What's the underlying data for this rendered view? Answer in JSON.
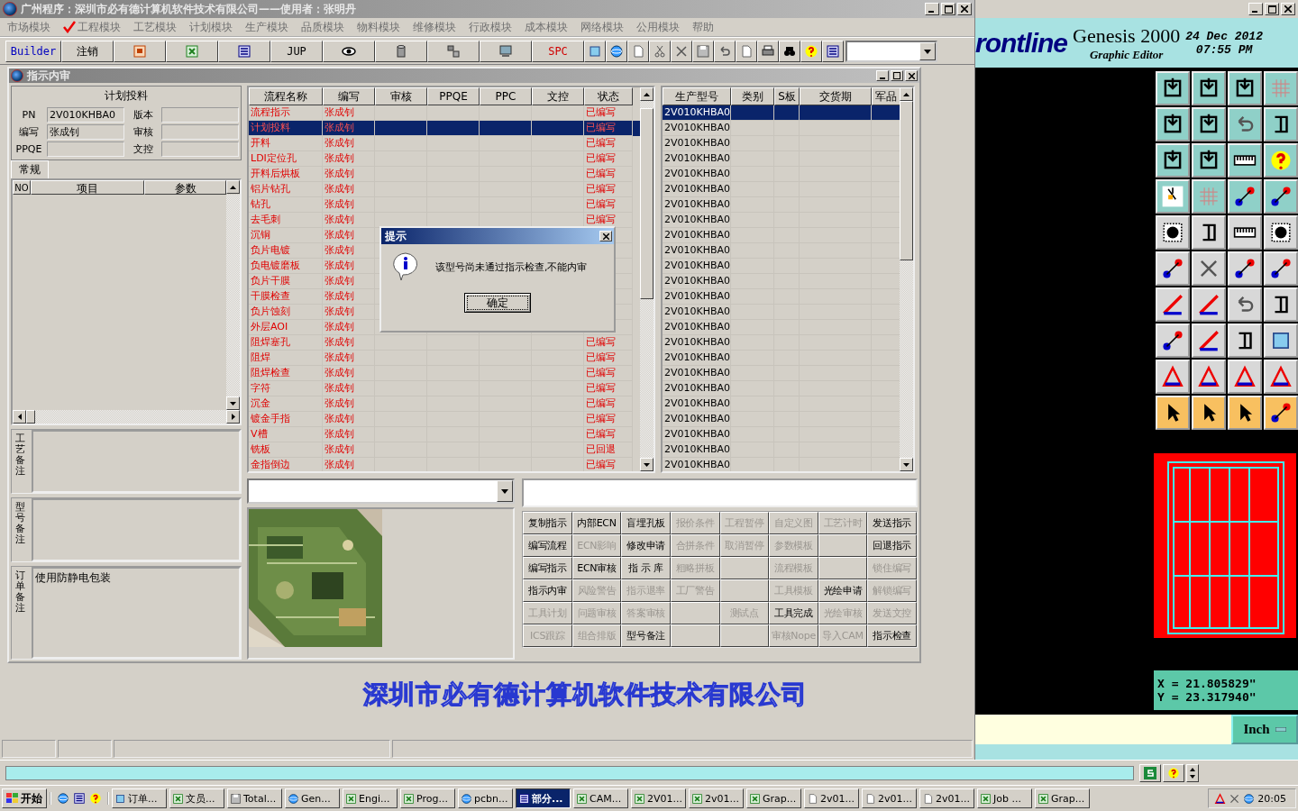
{
  "window": {
    "title": "广州程序：深圳市必有德计算机软件技术有限公司——使用者：张明丹"
  },
  "menu": [
    {
      "label": "市场模块",
      "checked": false
    },
    {
      "label": "工程模块",
      "checked": true
    },
    {
      "label": "工艺模块",
      "checked": false
    },
    {
      "label": "计划模块",
      "checked": false
    },
    {
      "label": "生产模块",
      "checked": false
    },
    {
      "label": "品质模块",
      "checked": false
    },
    {
      "label": "物料模块",
      "checked": false
    },
    {
      "label": "维修模块",
      "checked": false
    },
    {
      "label": "行政模块",
      "checked": false
    },
    {
      "label": "成本模块",
      "checked": false
    },
    {
      "label": "网络模块",
      "checked": false
    },
    {
      "label": "公用模块",
      "checked": false
    },
    {
      "label": "帮助",
      "checked": false
    }
  ],
  "toolbar": [
    {
      "kind": "label",
      "label": "Builder",
      "color": "#0000c0"
    },
    {
      "kind": "label",
      "label": "注销",
      "color": "#000000"
    },
    {
      "kind": "icon"
    },
    {
      "kind": "icon"
    },
    {
      "kind": "icon"
    },
    {
      "kind": "label",
      "label": "JUP",
      "color": "#000000"
    },
    {
      "kind": "icon"
    },
    {
      "kind": "icon"
    },
    {
      "kind": "icon"
    },
    {
      "kind": "icon"
    },
    {
      "kind": "label",
      "label": "SPC",
      "color": "#d00000"
    },
    {
      "kind": "small"
    },
    {
      "kind": "small"
    },
    {
      "kind": "small"
    },
    {
      "kind": "small"
    },
    {
      "kind": "small"
    },
    {
      "kind": "small"
    },
    {
      "kind": "small"
    },
    {
      "kind": "small"
    },
    {
      "kind": "small"
    },
    {
      "kind": "small"
    },
    {
      "kind": "small"
    },
    {
      "kind": "small"
    }
  ],
  "form": {
    "title": "指示内审",
    "plan": {
      "heading": "计划投料",
      "fields": [
        {
          "label": "PN",
          "value": "2V010KHBA0"
        },
        {
          "label": "版本"
        },
        {
          "label": "编写",
          "value": "张成钊"
        },
        {
          "label": "审核"
        },
        {
          "label": "PPQE"
        },
        {
          "label": "文控"
        }
      ]
    },
    "tab": "常规",
    "params_table": {
      "columns": [
        "NO",
        "项目",
        "参数"
      ]
    },
    "remarks": [
      {
        "label": "工艺备注"
      },
      {
        "label": "型号备注"
      },
      {
        "label": "订单备注",
        "value": "使用防静电包装"
      }
    ],
    "flow_table": {
      "columns": [
        "流程名称",
        "编写",
        "审核",
        "PPQE",
        "PPC",
        "文控",
        "状态"
      ],
      "rows": [
        {
          "name": "流程指示",
          "writer": "张成钊",
          "status": "已编写",
          "selected": false
        },
        {
          "name": "计划投料",
          "writer": "张成钊",
          "status": "已编写",
          "selected": true
        },
        {
          "name": "开料",
          "writer": "张成钊",
          "status": "已编写",
          "selected": false
        },
        {
          "name": "LDI定位孔",
          "writer": "张成钊",
          "status": "已编写",
          "selected": false
        },
        {
          "name": "开料后烘板",
          "writer": "张成钊",
          "status": "已编写",
          "selected": false
        },
        {
          "name": "铝片钻孔",
          "writer": "张成钊",
          "status": "已编写",
          "selected": false
        },
        {
          "name": "钻孔",
          "writer": "张成钊",
          "status": "已编写",
          "selected": false
        },
        {
          "name": "去毛刺",
          "writer": "张成钊",
          "status": "已编写",
          "selected": false
        },
        {
          "name": "沉铜",
          "writer": "张成钊",
          "selected": false
        },
        {
          "name": "负片电镀",
          "writer": "张成钊",
          "selected": false
        },
        {
          "name": "负电镀磨板",
          "writer": "张成钊",
          "selected": false
        },
        {
          "name": "负片干膜",
          "writer": "张成钊",
          "selected": false
        },
        {
          "name": "干膜检查",
          "writer": "张成钊",
          "selected": false
        },
        {
          "name": "负片蚀刻",
          "writer": "张成钊",
          "selected": false
        },
        {
          "name": "外层AOI",
          "writer": "张成钊",
          "selected": false
        },
        {
          "name": "阻焊塞孔",
          "writer": "张成钊",
          "status": "已编写",
          "selected": false
        },
        {
          "name": "阻焊",
          "writer": "张成钊",
          "status": "已编写",
          "selected": false
        },
        {
          "name": "阻焊检查",
          "writer": "张成钊",
          "status": "已编写",
          "selected": false
        },
        {
          "name": "字符",
          "writer": "张成钊",
          "status": "已编写",
          "selected": false
        },
        {
          "name": "沉金",
          "writer": "张成钊",
          "status": "已编写",
          "selected": false
        },
        {
          "name": "镀金手指",
          "writer": "张成钊",
          "status": "已编写",
          "selected": false
        },
        {
          "name": "V槽",
          "writer": "张成钊",
          "status": "已编写",
          "selected": false
        },
        {
          "name": "铣板",
          "writer": "张成钊",
          "status": "已回退",
          "selected": false
        },
        {
          "name": "金指倒边",
          "writer": "张成钊",
          "status": "已编写",
          "selected": false
        }
      ]
    },
    "model_table": {
      "columns": [
        "生产型号",
        "类别",
        "S板",
        "交货期",
        "军品"
      ],
      "rows": [
        {
          "model": "2V010KHBA0",
          "selected": true
        },
        {
          "model": "2V010KHBA0",
          "selected": false
        },
        {
          "model": "2V010KHBA0",
          "selected": false
        },
        {
          "model": "2V010KHBA0",
          "selected": false
        },
        {
          "model": "2V010KHBA0",
          "selected": false
        },
        {
          "model": "2V010KHBA0",
          "selected": false
        },
        {
          "model": "2V010KHBA0",
          "selected": false
        },
        {
          "model": "2V010KHBA0",
          "selected": false
        },
        {
          "model": "2V010KHBA0",
          "selected": false
        },
        {
          "model": "2V010KHBA0",
          "selected": false
        },
        {
          "model": "2V010KHBA0",
          "selected": false
        },
        {
          "model": "2V010KHBA0",
          "selected": false
        },
        {
          "model": "2V010KHBA0",
          "selected": false
        },
        {
          "model": "2V010KHBA0",
          "selected": false
        },
        {
          "model": "2V010KHBA0",
          "selected": false
        },
        {
          "model": "2V010KHBA0",
          "selected": false
        },
        {
          "model": "2V010KHBA0",
          "selected": false
        },
        {
          "model": "2V010KHBA0",
          "selected": false
        },
        {
          "model": "2V010KHBA0",
          "selected": false
        },
        {
          "model": "2V010KHBA0",
          "selected": false
        },
        {
          "model": "2V010KHBA0",
          "selected": false
        },
        {
          "model": "2V010KHBA0",
          "selected": false
        },
        {
          "model": "2V010KHBA0",
          "selected": false
        },
        {
          "model": "2V010KHBA0",
          "selected": false
        }
      ]
    },
    "actions": [
      {
        "label": "复制指示",
        "disabled": false
      },
      {
        "label": "内部ECN",
        "disabled": false
      },
      {
        "label": "盲埋孔板",
        "disabled": false
      },
      {
        "label": "报价条件",
        "disabled": true
      },
      {
        "label": "工程暂停",
        "disabled": true
      },
      {
        "label": "自定义图",
        "disabled": true
      },
      {
        "label": "工艺计时",
        "disabled": true
      },
      {
        "label": "发送指示",
        "disabled": false
      },
      {
        "label": "编写流程",
        "disabled": false
      },
      {
        "label": "ECN影响",
        "disabled": true
      },
      {
        "label": "修改申请",
        "disabled": false
      },
      {
        "label": "合拼条件",
        "disabled": true
      },
      {
        "label": "取消暂停",
        "disabled": true
      },
      {
        "label": "参数模板",
        "disabled": true
      },
      {
        "kind": "blank"
      },
      {
        "label": "回退指示",
        "disabled": false
      },
      {
        "label": "编写指示",
        "disabled": false
      },
      {
        "label": "ECN审核",
        "disabled": false
      },
      {
        "label": "指 示 库",
        "disabled": false
      },
      {
        "label": "粗略拼板",
        "disabled": true
      },
      {
        "kind": "blank"
      },
      {
        "label": "流程模板",
        "disabled": true
      },
      {
        "kind": "blank"
      },
      {
        "label": "锁住编写",
        "disabled": true
      },
      {
        "label": "指示内审",
        "disabled": false
      },
      {
        "label": "风险警告",
        "disabled": true
      },
      {
        "label": "指示退率",
        "disabled": true
      },
      {
        "label": "工厂警告",
        "disabled": true
      },
      {
        "kind": "blank"
      },
      {
        "label": "工具模板",
        "disabled": true
      },
      {
        "label": "光绘申请",
        "disabled": false
      },
      {
        "label": "解锁编写",
        "disabled": true
      },
      {
        "label": "工具计划",
        "disabled": true
      },
      {
        "label": "问题审核",
        "disabled": true
      },
      {
        "label": "答案审核",
        "disabled": true
      },
      {
        "kind": "blank"
      },
      {
        "label": "测试点",
        "disabled": true
      },
      {
        "label": "工具完成",
        "disabled": false
      },
      {
        "label": "光绘审核",
        "disabled": true
      },
      {
        "label": "发送文控",
        "disabled": true
      },
      {
        "label": "ICS跟踪",
        "disabled": true
      },
      {
        "label": "组合排版",
        "disabled": true
      },
      {
        "label": "型号备注",
        "disabled": false
      },
      {
        "kind": "blank"
      },
      {
        "kind": "blank"
      },
      {
        "label": "审核Nope",
        "disabled": true
      },
      {
        "label": "导入CAM",
        "disabled": true
      },
      {
        "label": "指示检查",
        "disabled": false
      }
    ]
  },
  "dialog": {
    "title": "提示",
    "message": "该型号尚未通过指示检查,不能内审",
    "button": "确定"
  },
  "banner": "深圳市必有德计算机软件技术有限公司",
  "genesis": {
    "logo": "rontline",
    "title": "Genesis 2000",
    "date": "24 Dec 2012",
    "time": "07:55 PM",
    "subtitle": "Graphic Editor",
    "x": "X = 21.805829\"",
    "y": "Y = 23.317940\"",
    "units": "Inch"
  },
  "taskbar": {
    "start": "开始",
    "items": [
      {
        "label": "订单...",
        "active": false
      },
      {
        "label": "文员...",
        "active": false
      },
      {
        "label": "Total...",
        "active": false
      },
      {
        "label": "Gen...",
        "active": false
      },
      {
        "label": "Engi...",
        "active": false
      },
      {
        "label": "Prog...",
        "active": false
      },
      {
        "label": "pcbn...",
        "active": false
      },
      {
        "label": "部分...",
        "active": true
      },
      {
        "label": "CAM...",
        "active": false
      },
      {
        "label": "2V01...",
        "active": false
      },
      {
        "label": "2v01...",
        "active": false
      },
      {
        "label": "Grap...",
        "active": false
      },
      {
        "label": "2v01...",
        "active": false
      },
      {
        "label": "2v01...",
        "active": false
      },
      {
        "label": "2v01...",
        "active": false
      },
      {
        "label": "Job ...",
        "active": false
      },
      {
        "label": "Grap...",
        "active": false
      }
    ],
    "clock": "20:05"
  }
}
